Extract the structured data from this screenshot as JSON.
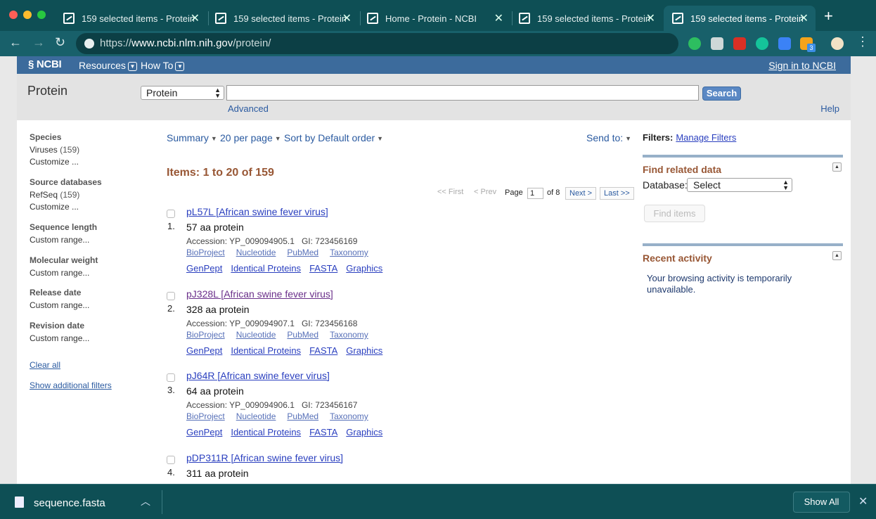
{
  "browser": {
    "tabs": [
      {
        "title": "159 selected items - Protein",
        "active": false
      },
      {
        "title": "159 selected items - Protein",
        "active": false
      },
      {
        "title": "Home - Protein - NCBI",
        "active": false
      },
      {
        "title": "159 selected items - Protein",
        "active": false
      },
      {
        "title": "159 selected items - Protein",
        "active": true
      }
    ],
    "url_prefix": "https://",
    "url_host": "www.ncbi.nlm.nih.gov",
    "url_path": "/protein/",
    "extension_badge": "3",
    "colors": {
      "chrome": "#0e4f55",
      "toolbar": "#18606a"
    }
  },
  "ncbi": {
    "logo": "NCBI",
    "menu": {
      "resources": "Resources",
      "howto": "How To"
    },
    "signin": "Sign in to NCBI",
    "db_title": "Protein",
    "db_select_value": "Protein",
    "search_term": "",
    "search_button": "Search",
    "advanced": "Advanced",
    "help": "Help"
  },
  "sidebar": {
    "groups": [
      {
        "heading": "Species",
        "items": [
          {
            "label": "Viruses",
            "count": "(159)"
          },
          {
            "label": "Customize ...",
            "count": ""
          }
        ]
      },
      {
        "heading": "Source databases",
        "items": [
          {
            "label": "RefSeq",
            "count": "(159)"
          },
          {
            "label": "Customize ...",
            "count": ""
          }
        ]
      },
      {
        "heading": "Sequence length",
        "items": [
          {
            "label": "Custom range...",
            "count": ""
          }
        ]
      },
      {
        "heading": "Molecular weight",
        "items": [
          {
            "label": "Custom range...",
            "count": ""
          }
        ]
      },
      {
        "heading": "Release date",
        "items": [
          {
            "label": "Custom range...",
            "count": ""
          }
        ]
      },
      {
        "heading": "Revision date",
        "items": [
          {
            "label": "Custom range...",
            "count": ""
          }
        ]
      }
    ],
    "clear_all": "Clear all",
    "show_additional": "Show additional filters"
  },
  "display": {
    "format": "Summary",
    "per_page": "20 per page",
    "sort": "Sort by Default order",
    "send_to": "Send to:"
  },
  "results": {
    "items_label": "Items: 1 to 20 of 159",
    "pager": {
      "first": "<< First",
      "prev": "< Prev",
      "page_label": "Page",
      "page": "1",
      "of": "of 8",
      "next": "Next >",
      "last": "Last >>"
    },
    "accession_label": "Accession:",
    "gi_label": "GI:",
    "link_row1": [
      "BioProject",
      "Nucleotide",
      "PubMed",
      "Taxonomy"
    ],
    "link_row2": [
      "GenPept",
      "Identical Proteins",
      "FASTA",
      "Graphics"
    ],
    "items": [
      {
        "num": "1.",
        "title": "pL57L [African swine fever virus]",
        "desc": "57 aa protein",
        "accession": "YP_009094905.1",
        "gi": "723456169",
        "visited": false
      },
      {
        "num": "2.",
        "title": "pJ328L [African swine fever virus]",
        "desc": "328 aa protein",
        "accession": "YP_009094907.1",
        "gi": "723456168",
        "visited": true
      },
      {
        "num": "3.",
        "title": "pJ64R [African swine fever virus]",
        "desc": "64 aa protein",
        "accession": "YP_009094906.1",
        "gi": "723456167",
        "visited": false
      },
      {
        "num": "4.",
        "title": "pDP311R [African swine fever virus]",
        "desc": "311 aa protein",
        "accession": "",
        "gi": "",
        "visited": false
      }
    ]
  },
  "right": {
    "filters_label": "Filters:",
    "manage_filters": "Manage Filters",
    "find_related": "Find related data",
    "database_label": "Database:",
    "database_value": "Select",
    "find_items": "Find items",
    "recent_activity": "Recent activity",
    "recent_text": "Your browsing activity is temporarily unavailable."
  },
  "downloads": {
    "file": "sequence.fasta",
    "show_all": "Show All"
  }
}
